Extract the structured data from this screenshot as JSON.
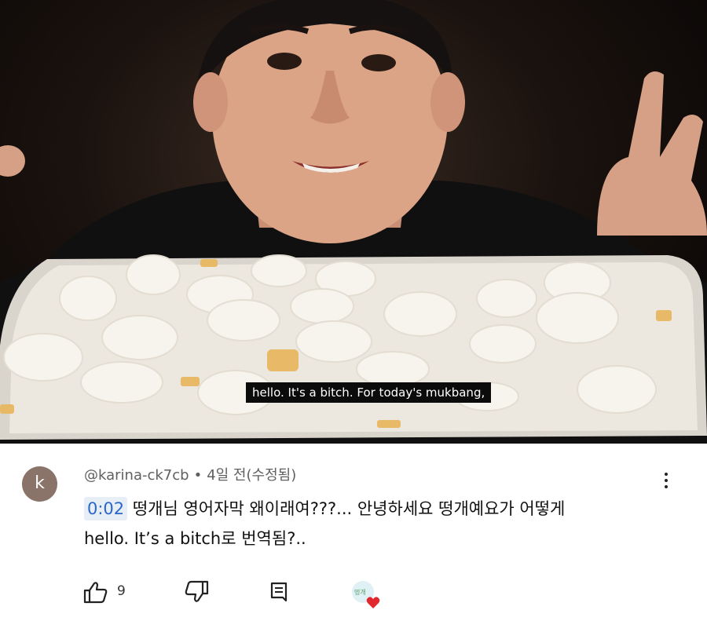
{
  "video": {
    "subtitle": "hello. It's a bitch. For today's mukbang,"
  },
  "comment": {
    "avatar_letter": "k",
    "author": "@karina-ck7cb",
    "separator": "•",
    "time": "4일 전(수정됨)",
    "timestamp": "0:02",
    "text_line1": " 떵개님 영어자막 왜이래여???... 안녕하세요 떵개예요가 어떻게",
    "text_line2": "hello. It’s a bitch로 번역됨?..",
    "like_count": "9",
    "icons": [
      "thumbs-up-icon",
      "thumbs-down-icon",
      "reply-icon",
      "creator-heart-icon",
      "more-vert-icon"
    ],
    "colors": {
      "timestamp_text": "#2a67c9",
      "timestamp_bg": "#e8eef6",
      "heart": "#e0282e"
    }
  }
}
